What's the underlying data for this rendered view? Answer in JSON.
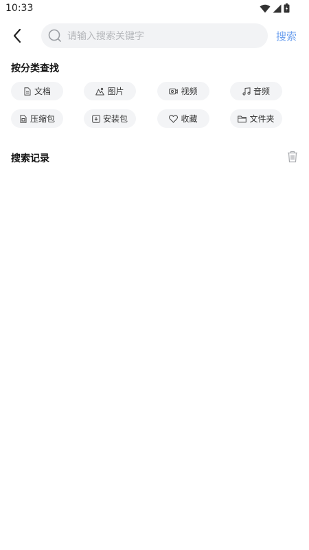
{
  "status": {
    "time": "10:33"
  },
  "search": {
    "placeholder": "请输入搜索关键字",
    "value": "",
    "button_label": "搜索"
  },
  "categories": {
    "title": "按分类查找",
    "items": [
      {
        "label": "文档",
        "icon": "document-icon"
      },
      {
        "label": "图片",
        "icon": "image-icon"
      },
      {
        "label": "视频",
        "icon": "video-icon"
      },
      {
        "label": "音频",
        "icon": "music-icon"
      },
      {
        "label": "压缩包",
        "icon": "archive-icon"
      },
      {
        "label": "安装包",
        "icon": "install-package-icon"
      },
      {
        "label": "收藏",
        "icon": "heart-icon"
      },
      {
        "label": "文件夹",
        "icon": "folder-icon"
      }
    ]
  },
  "history": {
    "title": "搜索记录",
    "items": []
  },
  "colors": {
    "accent": "#6ea1ef",
    "chip_bg": "#f3f4f6",
    "search_bg": "#f2f3f5"
  }
}
